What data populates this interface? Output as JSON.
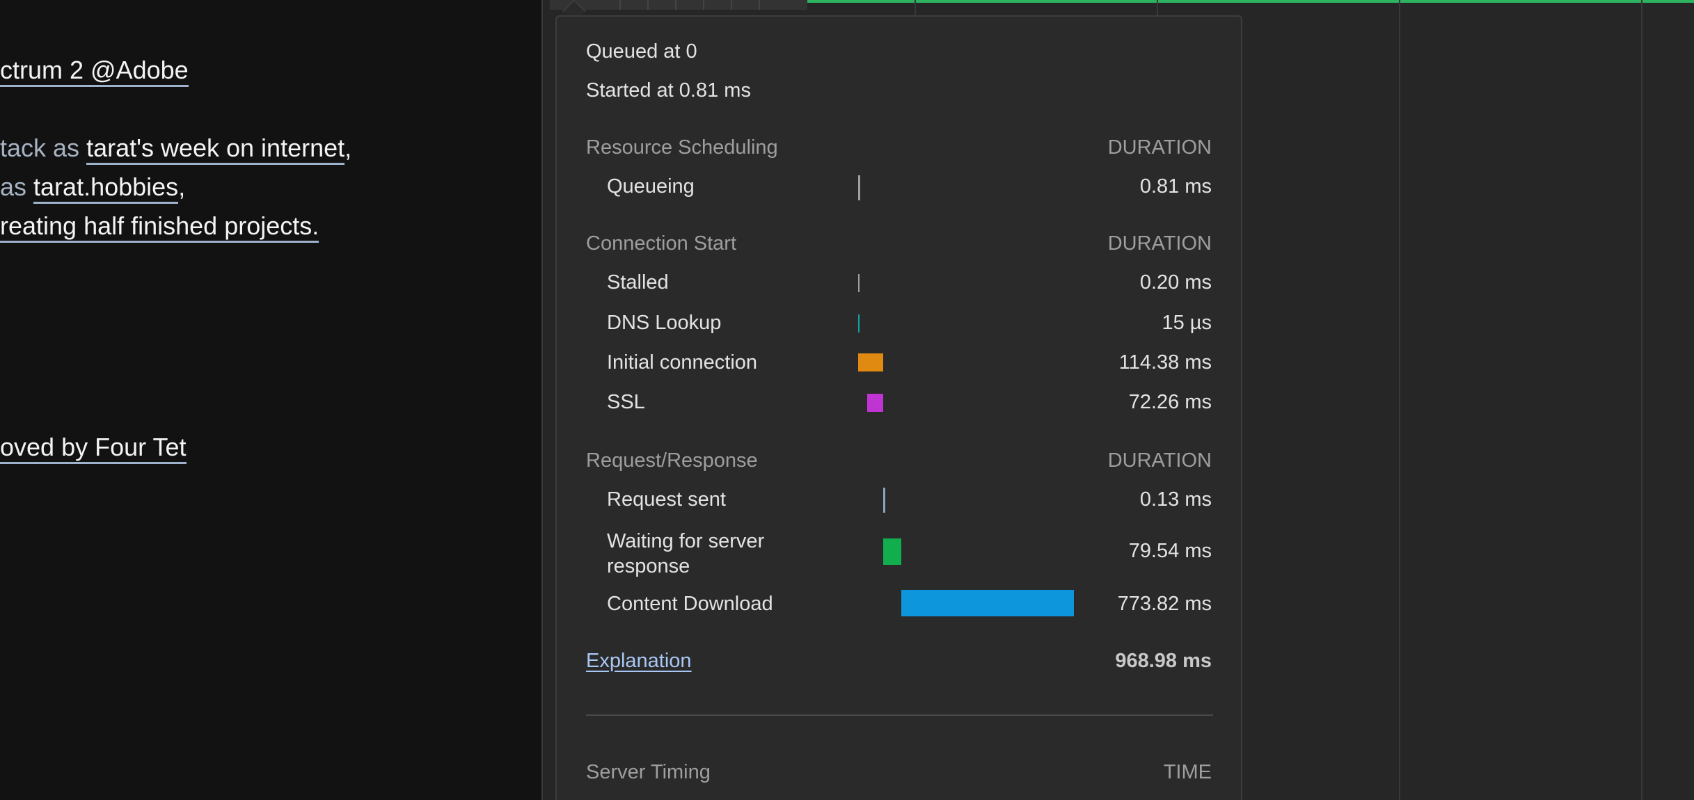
{
  "page": {
    "line1": {
      "link": "ctrum 2 @Adobe"
    },
    "line2": {
      "prefix": "tack as ",
      "link": "tarat's week on internet",
      "suffix": ","
    },
    "line3": {
      "prefix": " as ",
      "link": "tarat.hobbies",
      "suffix": ","
    },
    "line4": {
      "link": "reating half finished projects."
    },
    "line5": {
      "link": "oved by Four Tet"
    }
  },
  "timing": {
    "queued_at": "Queued at 0",
    "started_at": "Started at 0.81 ms",
    "sections": [
      {
        "title": "Resource Scheduling",
        "col": "DURATION",
        "rows": [
          {
            "label": "Queueing",
            "duration": "0.81 ms",
            "color": "#9e9e9e"
          }
        ]
      },
      {
        "title": "Connection Start",
        "col": "DURATION",
        "rows": [
          {
            "label": "Stalled",
            "duration": "0.20 ms",
            "color": "#9e9e9e"
          },
          {
            "label": "DNS Lookup",
            "duration": "15 µs",
            "color": "#12a4a4"
          },
          {
            "label": "Initial connection",
            "duration": "114.38 ms",
            "color": "#e08a11"
          },
          {
            "label": "SSL",
            "duration": "72.26 ms",
            "color": "#c034d3"
          }
        ]
      },
      {
        "title": "Request/Response",
        "col": "DURATION",
        "rows": [
          {
            "label": "Request sent",
            "duration": "0.13 ms",
            "color": "#8fa3bf"
          },
          {
            "label": "Waiting for server response",
            "duration": "79.54 ms",
            "color": "#12ad4c"
          },
          {
            "label": "Content Download",
            "duration": "773.82 ms",
            "color": "#0e96dc"
          }
        ]
      }
    ],
    "explanation": "Explanation",
    "total": "968.98 ms",
    "server_timing": {
      "title": "Server Timing",
      "col": "TIME"
    }
  }
}
